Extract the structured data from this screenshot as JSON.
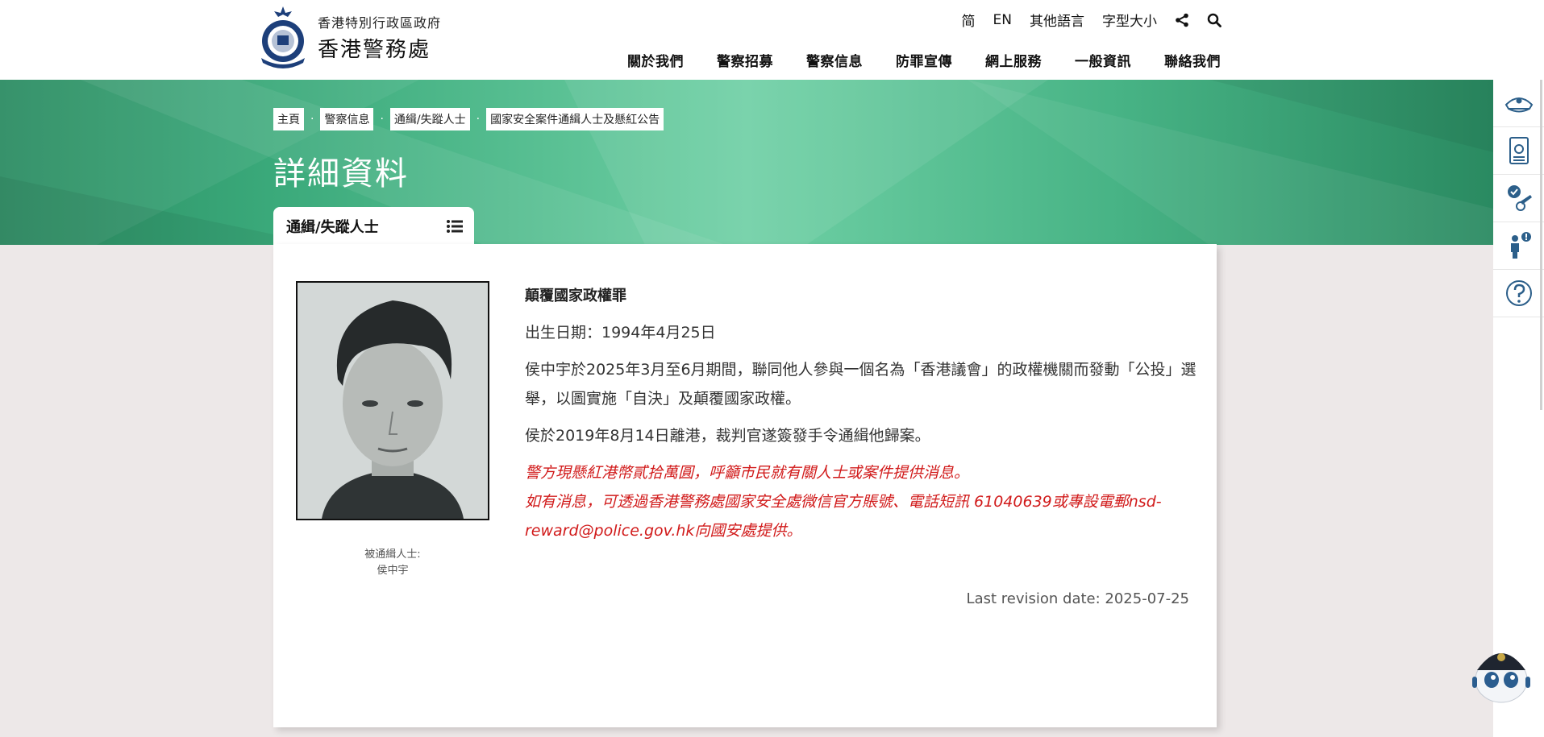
{
  "header": {
    "gov_name": "香港特別行政區政府",
    "police_name": "香港警務處",
    "utility": {
      "simplified": "简",
      "english": "EN",
      "other_lang": "其他語言",
      "font_size": "字型大小"
    },
    "nav": [
      "關於我們",
      "警察招募",
      "警察信息",
      "防罪宣傳",
      "網上服務",
      "一般資訊",
      "聯絡我們"
    ]
  },
  "breadcrumb": [
    "主頁",
    "警察信息",
    "通緝/失蹤人士",
    "國家安全案件通緝人士及懸紅公告"
  ],
  "page_title": "詳細資料",
  "tab": {
    "label": "通緝/失蹤人士"
  },
  "person": {
    "caption_label": "被通緝人士:",
    "caption_name": "侯中宇",
    "crime": "顛覆國家政權罪",
    "dob": "出生日期：1994年4月25日",
    "desc1": "侯中宇於2025年3月至6月期間，聯同他人參與一個名為「香港議會」的政權機關而發動「公投」選舉，以圖實施「自決」及顛覆國家政權。",
    "desc2": "侯於2019年8月14日離港，裁判官遂簽發手令通緝他歸案。",
    "reward1": "警方現懸紅港幣貳拾萬圓，呼籲市民就有關人士或案件提供消息。",
    "reward2": "如有消息，可透過香港警務處國家安全處微信官方賬號、電話短訊 61040639或專設電郵nsd-reward@police.gov.hk向國安處提供。"
  },
  "revision": "Last revision date: 2025-07-25",
  "colors": {
    "banner_green": "#3aa97a",
    "alert_red": "#d11a1a",
    "icon_blue": "#2c5f8a"
  }
}
